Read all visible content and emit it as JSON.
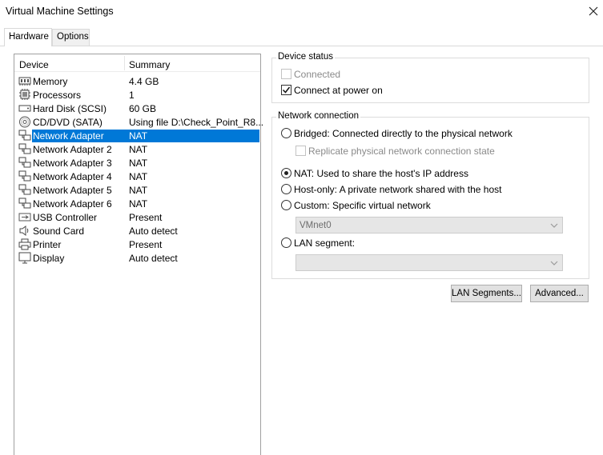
{
  "window": {
    "title": "Virtual Machine Settings",
    "close_icon": "close-icon"
  },
  "tabs": [
    {
      "label": "Hardware",
      "active": true
    },
    {
      "label": "Options",
      "active": false
    }
  ],
  "device_list": {
    "col_device": "Device",
    "col_summary": "Summary",
    "selected_index": 4,
    "items": [
      {
        "icon": "memory-icon",
        "name": "Memory",
        "summary": "4.4 GB"
      },
      {
        "icon": "processor-icon",
        "name": "Processors",
        "summary": "1"
      },
      {
        "icon": "hard-disk-icon",
        "name": "Hard Disk (SCSI)",
        "summary": "60 GB"
      },
      {
        "icon": "cd-dvd-icon",
        "name": "CD/DVD (SATA)",
        "summary": "Using file D:\\Check_Point_R8..."
      },
      {
        "icon": "network-adapter-icon",
        "name": "Network Adapter",
        "summary": "NAT"
      },
      {
        "icon": "network-adapter-icon",
        "name": "Network Adapter 2",
        "summary": "NAT"
      },
      {
        "icon": "network-adapter-icon",
        "name": "Network Adapter 3",
        "summary": "NAT"
      },
      {
        "icon": "network-adapter-icon",
        "name": "Network Adapter 4",
        "summary": "NAT"
      },
      {
        "icon": "network-adapter-icon",
        "name": "Network Adapter 5",
        "summary": "NAT"
      },
      {
        "icon": "network-adapter-icon",
        "name": "Network Adapter 6",
        "summary": "NAT"
      },
      {
        "icon": "usb-icon",
        "name": "USB Controller",
        "summary": "Present"
      },
      {
        "icon": "sound-card-icon",
        "name": "Sound Card",
        "summary": "Auto detect"
      },
      {
        "icon": "printer-icon",
        "name": "Printer",
        "summary": "Present"
      },
      {
        "icon": "display-icon",
        "name": "Display",
        "summary": "Auto detect"
      }
    ]
  },
  "device_status": {
    "title": "Device status",
    "connected": {
      "label": "Connected",
      "checked": false,
      "enabled": false
    },
    "connect_at_power_on": {
      "label": "Connect at power on",
      "checked": true,
      "enabled": true
    }
  },
  "network_connection": {
    "title": "Network connection",
    "bridged": {
      "label": "Bridged: Connected directly to the physical network",
      "selected": false
    },
    "replicate": {
      "label": "Replicate physical network connection state",
      "checked": false,
      "enabled": false
    },
    "nat": {
      "label": "NAT: Used to share the host's IP address",
      "selected": true
    },
    "host_only": {
      "label": "Host-only: A private network shared with the host",
      "selected": false
    },
    "custom": {
      "label": "Custom: Specific virtual network",
      "selected": false
    },
    "custom_value": "VMnet0",
    "lan_segment": {
      "label": "LAN segment:",
      "selected": false
    },
    "lan_segment_value": ""
  },
  "buttons": {
    "lan_segments": "LAN Segments...",
    "advanced": "Advanced..."
  },
  "colors": {
    "selection": "#0078d7",
    "disabled_text": "#8a8a8a"
  }
}
